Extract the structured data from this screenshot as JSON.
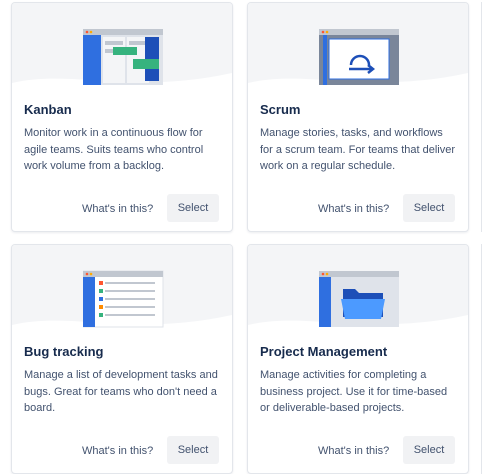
{
  "cards": [
    {
      "title": "Kanban",
      "description": "Monitor work in a continuous flow for agile teams. Suits teams who control work volume from a backlog.",
      "whats_label": "What's in this?",
      "select_label": "Select"
    },
    {
      "title": "Scrum",
      "description": "Manage stories, tasks, and workflows for a scrum team. For teams that deliver work on a regular schedule.",
      "whats_label": "What's in this?",
      "select_label": "Select"
    },
    {
      "title": "Bug tracking",
      "description": "Manage a list of development tasks and bugs. Great for teams who don't need a board.",
      "whats_label": "What's in this?",
      "select_label": "Select"
    },
    {
      "title": "Project Management",
      "description": "Manage activities for completing a business project. Use it for time-based or deliverable-based projects.",
      "whats_label": "What's in this?",
      "select_label": "Select"
    }
  ],
  "colors": {
    "accent_blue": "#2f6fe0",
    "dark_blue": "#1d4fb8",
    "green": "#36b37e",
    "text_primary": "#172b4d",
    "text_secondary": "#42526e"
  },
  "icons": [
    "kanban-board-icon",
    "scrum-cycle-icon",
    "bug-list-icon",
    "folder-icon"
  ]
}
